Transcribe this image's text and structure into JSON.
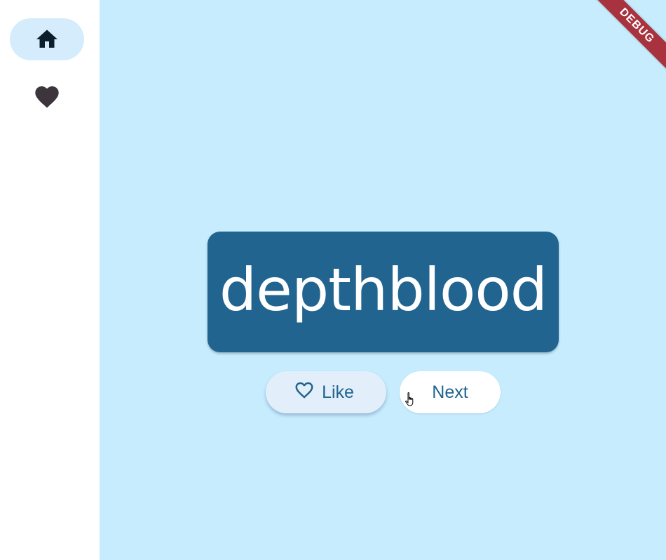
{
  "rail": {
    "items": [
      {
        "name": "home",
        "icon": "home-icon",
        "selected": true
      },
      {
        "name": "favorites",
        "icon": "heart-icon",
        "selected": false
      }
    ]
  },
  "main": {
    "word": "depthblood",
    "like_button": {
      "label": "Like",
      "icon": "heart-outline-icon"
    },
    "next_button": {
      "label": "Next"
    }
  },
  "debug_banner": {
    "label": "DEBUG"
  },
  "colors": {
    "rail_background": "#ffffff",
    "rail_selected": "#d4ecfb",
    "content_background": "#c6ecfe",
    "card": "#21648f",
    "card_text": "#ffffff",
    "button_text": "#21648f",
    "debug": "#a8323e"
  }
}
